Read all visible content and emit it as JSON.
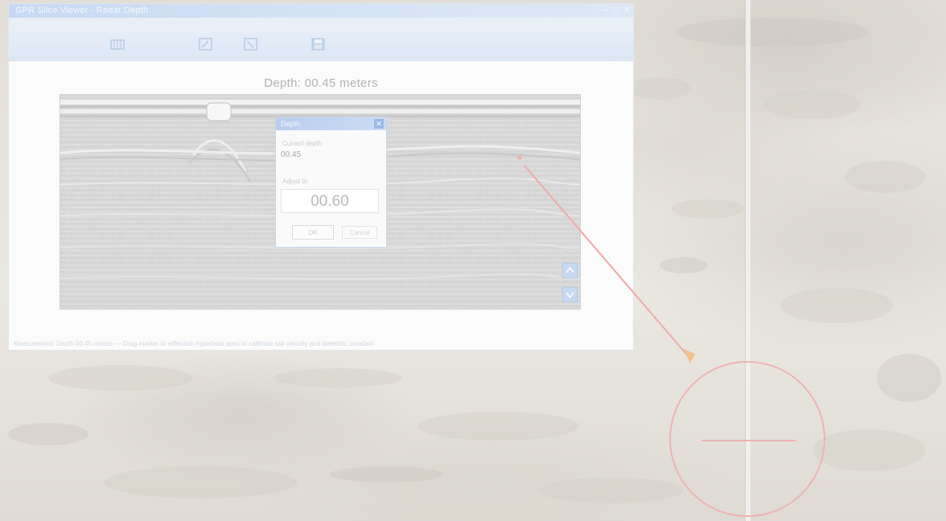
{
  "window": {
    "title": "GPR Slice Viewer - Radar Depth",
    "minimize": "–",
    "maximize": "□",
    "close": "✕",
    "toolbar_extra_text": "",
    "status_text": "Measurement: Depth 00.45 meters — Drag marker to reflection hyperbola apex to calibrate soil velocity and dielectric constant"
  },
  "plot": {
    "title": "Depth: 00.45 meters",
    "y_label": "",
    "y2_label": "",
    "x_label": ""
  },
  "dialog": {
    "title": "Depth",
    "close_glyph": "✕",
    "current_label": "Current depth",
    "current_value": "00.45",
    "adjust_label": "Adjust to",
    "adjust_value": "00.60",
    "ok_label": "OK",
    "cancel_label": "Cancel"
  },
  "icons": {
    "toolbar": [
      "measure-icon",
      "zoom-in-icon",
      "zoom-out-icon",
      "save-icon"
    ],
    "nav": [
      "scroll-up-icon",
      "scroll-down-icon"
    ]
  },
  "colors": {
    "accent": "#c6d9f2",
    "annotation": "#e98a8a"
  }
}
